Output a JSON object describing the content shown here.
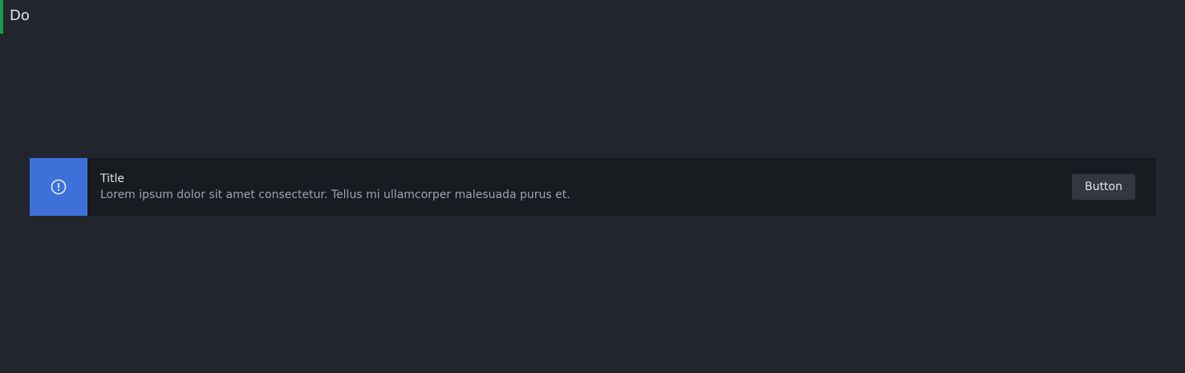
{
  "section": {
    "label": "Do",
    "accent_color": "#1f9a4a"
  },
  "alert": {
    "icon": "exclamation-circle-icon",
    "icon_bg_color": "#3d71d9",
    "title": "Title",
    "body": "Lorem ipsum dolor sit amet consectetur. Tellus mi ullamcorper malesuada purus et.",
    "button_label": "Button"
  }
}
